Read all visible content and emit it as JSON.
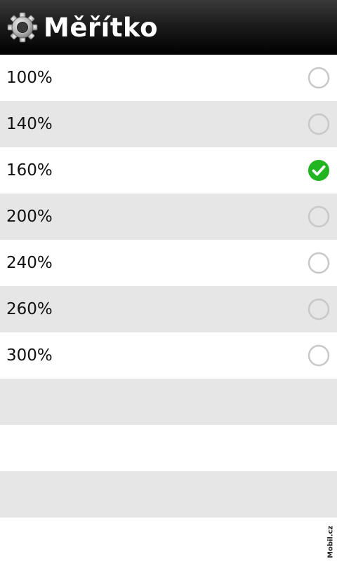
{
  "header": {
    "title": "Měřítko",
    "icon": "gear-icon"
  },
  "options": [
    {
      "label": "100%",
      "selected": false
    },
    {
      "label": "140%",
      "selected": false
    },
    {
      "label": "160%",
      "selected": true
    },
    {
      "label": "200%",
      "selected": false
    },
    {
      "label": "240%",
      "selected": false
    },
    {
      "label": "260%",
      "selected": false
    },
    {
      "label": "300%",
      "selected": false
    }
  ],
  "watermark": "Mobil.cz",
  "colors": {
    "check_green": "#22b522",
    "radio_ring": "#c8c8c8",
    "alt_row": "#e6e6e6"
  }
}
